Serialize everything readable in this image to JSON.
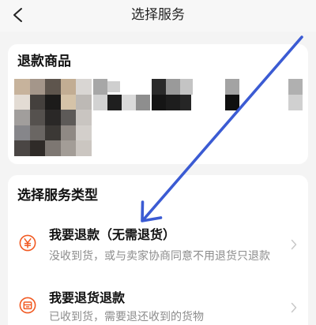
{
  "header": {
    "title": "选择服务",
    "back_icon": "chevron-left-icon"
  },
  "product_card": {
    "title": "退款商品"
  },
  "service_card": {
    "title": "选择服务类型",
    "options": [
      {
        "label": "我要退款（无需退货）",
        "description": "没收到货，或与卖家协商同意不用退货只退款",
        "icon": "yuan-circle-icon",
        "chevron_icon": "chevron-right-icon"
      },
      {
        "label": "我要退货退款",
        "description": "已收到货，需要退还收到的货物",
        "icon": "return-package-icon",
        "chevron_icon": "chevron-right-icon"
      }
    ]
  },
  "colors": {
    "page_background": "#f4f4f4",
    "card_background": "#ffffff",
    "accent": "#f15a22",
    "annotation_arrow": "#3b5bd3",
    "primary_text": "#111111",
    "secondary_text": "#8c8c8c"
  }
}
